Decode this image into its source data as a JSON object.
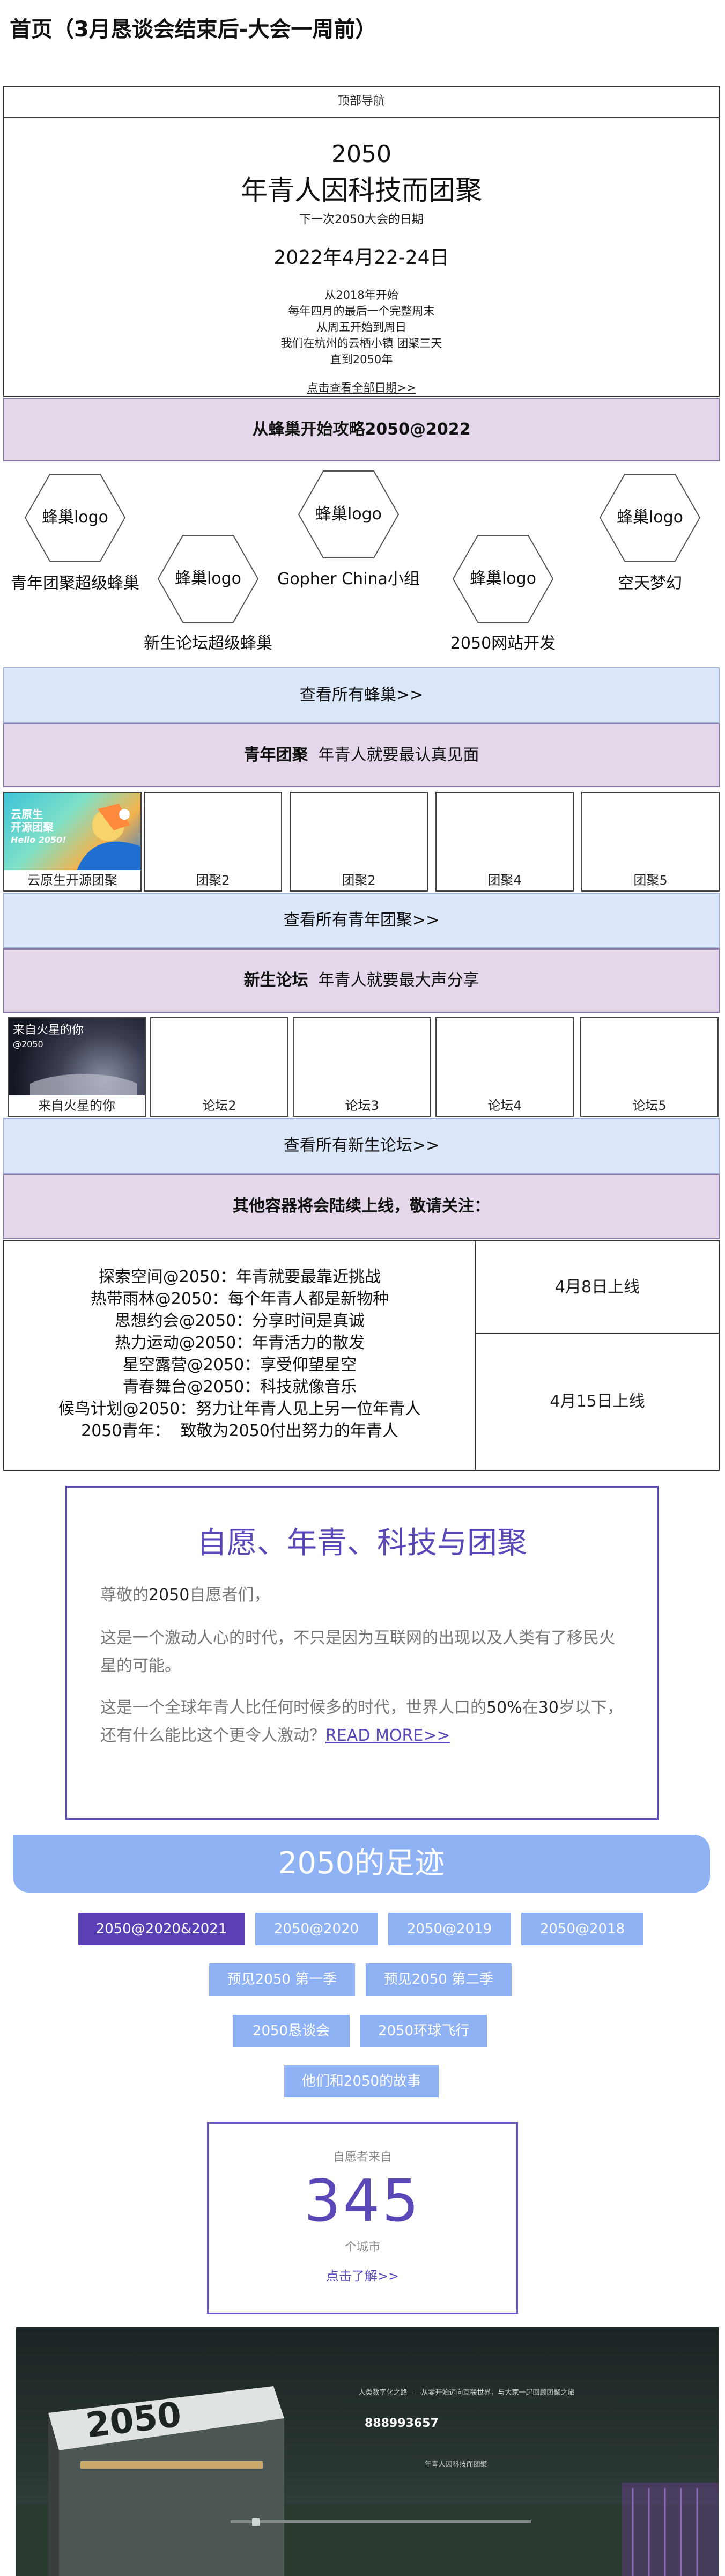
{
  "page": {
    "title": "首页（3月恳谈会结束后-大会一周前）"
  },
  "nav": {
    "label": "顶部导航"
  },
  "hero": {
    "year": "2050",
    "slogan": "年青人因科技而团聚",
    "next_label": "下一次2050大会的日期",
    "date": "2022年4月22-24日",
    "lines": [
      "从2018年开始",
      "每年四月的最后一个完整周末",
      "从周五开始到周日",
      "我们在杭州的云栖小镇 团聚三天",
      "直到2050年"
    ],
    "link": "点击查看全部日期>>"
  },
  "strategy": {
    "title": "从蜂巢开始攻略2050@2022"
  },
  "hives": [
    {
      "logo": "蜂巢logo",
      "name": "青年团聚超级蜂巢"
    },
    {
      "logo": "蜂巢logo",
      "name": "新生论坛超级蜂巢"
    },
    {
      "logo": "蜂巢logo",
      "name": "Gopher China小组"
    },
    {
      "logo": "蜂巢logo",
      "name": "2050网站开发"
    },
    {
      "logo": "蜂巢logo",
      "name": "空天梦幻"
    }
  ],
  "view_all_hives": "查看所有蜂巢>>",
  "youth": {
    "title": "青年团聚",
    "subtitle": "年青人就要最认真见面",
    "banner_text": [
      "云原生",
      "开源团聚",
      "Hello 2050!"
    ],
    "cards": [
      "云原生开源团聚",
      "团聚2",
      "团聚2",
      "团聚4",
      "团聚5"
    ],
    "view_all": "查看所有青年团聚>>"
  },
  "forum": {
    "title": "新生论坛",
    "subtitle": "年青人就要最大声分享",
    "banner_text": [
      "来自火星的你",
      "@2050"
    ],
    "cards": [
      "来自火星的你",
      "论坛2",
      "论坛3",
      "论坛4",
      "论坛5"
    ],
    "view_all": "查看所有新生论坛>>"
  },
  "others": {
    "title": "其他容器将会陆续上线，敬请关注：",
    "items": [
      "探索空间@2050：年青就要最靠近挑战",
      "热带雨林@2050：每个年青人都是新物种",
      "思想约会@2050：分享时间是真诚",
      "热力运动@2050：年青活力的散发",
      "星空露营@2050：享受仰望星空",
      "青春舞台@2050：科技就像音乐",
      "候鸟计划@2050：努力让年青人见上另一位年青人",
      "2050青年：  致敬为2050付出努力的年青人"
    ],
    "date1": "4月8日上线",
    "date2": "4月15日上线"
  },
  "volunteer": {
    "title": "自愿、年青、科技与团聚",
    "greeting_pre": "尊敬的",
    "greeting_num": "2050",
    "greeting_post": "自愿者们，",
    "p2": "这是一个激动人心的时代，不只是因为互联网的出现以及人类有了移民火星的可能。",
    "p3_pre": "这是一个全球年青人比任何时候多的时代，世界人口的",
    "p3_pct": "50%",
    "p3_mid": "在",
    "p3_num": "30",
    "p3_post": "岁以下，还有什么能比这个更令人激动？",
    "read_more": "READ MORE>>"
  },
  "footprints": {
    "title": "2050的足迹",
    "tabs": [
      "2050@2020&2021",
      "2050@2020",
      "2050@2019",
      "2050@2018",
      "预见2050 第一季",
      "预见2050 第二季",
      "2050恳谈会",
      "2050环球飞行",
      "他们和2050的故事"
    ]
  },
  "stats": {
    "label": "自愿者来自",
    "number": "345",
    "unit": "个城市",
    "link": "点击了解>>"
  },
  "photo": {
    "sign": "2050",
    "counter": "888993657",
    "lines": [
      "人类数字化之路——从零开始迈向互联世界，与大家一起回顾团聚之旅",
      "年青人因科技而团聚"
    ]
  },
  "colors": {
    "accent": "#5b47b8",
    "light_blue": "#8fb2f4",
    "lavender": "#e4d7ea",
    "pale_blue": "#dbe7f8"
  }
}
